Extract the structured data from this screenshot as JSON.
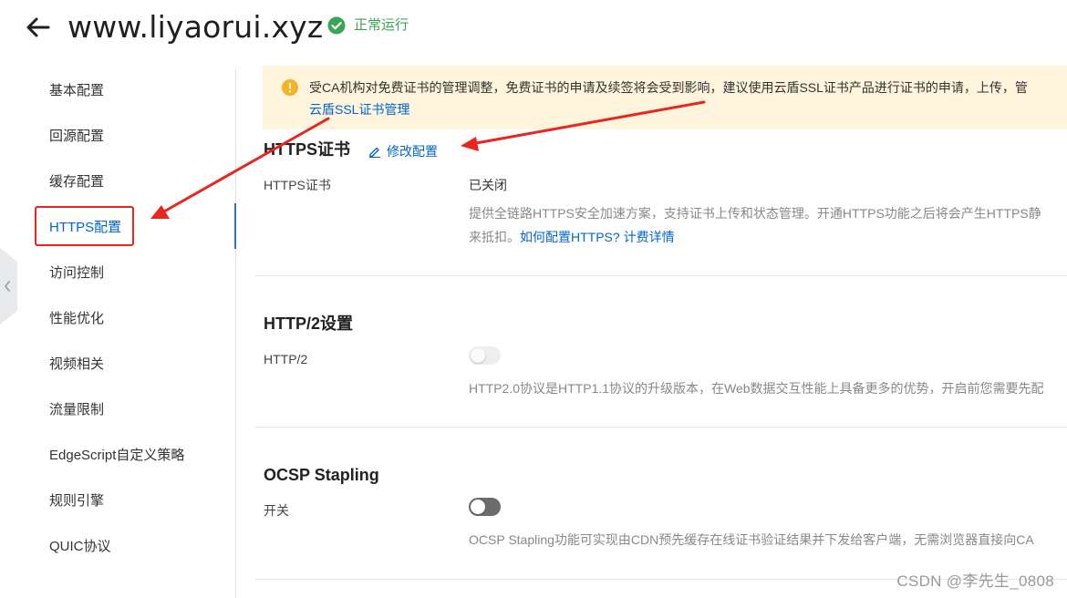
{
  "header": {
    "back_icon": "arrow-left-icon",
    "title": "www.liyaorui.xyz",
    "status_icon": "check-circle-icon",
    "status_text": "正常运行",
    "status_color": "#3aa655"
  },
  "sidebar": {
    "items": [
      {
        "label": "基本配置",
        "active": false
      },
      {
        "label": "回源配置",
        "active": false
      },
      {
        "label": "缓存配置",
        "active": false
      },
      {
        "label": "HTTPS配置",
        "active": true
      },
      {
        "label": "访问控制",
        "active": false
      },
      {
        "label": "性能优化",
        "active": false
      },
      {
        "label": "视频相关",
        "active": false
      },
      {
        "label": "流量限制",
        "active": false
      },
      {
        "label": "EdgeScript自定义策略",
        "active": false
      },
      {
        "label": "规则引擎",
        "active": false
      },
      {
        "label": "QUIC协议",
        "active": false
      }
    ]
  },
  "notice": {
    "icon": "warning-circle-icon",
    "text": "受CA机构对免费证书的管理调整，免费证书的申请及续签将会受到影响，建议使用云盾SSL证书产品进行证书的申请，上传，管",
    "link": "云盾SSL证书管理"
  },
  "https_section": {
    "title": "HTTPS证书",
    "edit_icon": "pencil-icon",
    "edit_label": "修改配置",
    "field_label": "HTTPS证书",
    "field_value": "已关闭",
    "desc_line1": "提供全链路HTTPS安全加速方案，支持证书上传和状态管理。开通HTTPS功能之后将会产生HTTPS静",
    "desc_line2_prefix": "来抵扣。",
    "desc_link1": "如何配置HTTPS?",
    "desc_link2": "计费详情"
  },
  "http2_section": {
    "title": "HTTP/2设置",
    "field_label": "HTTP/2",
    "toggle_on": false,
    "toggle_disabled": true,
    "desc": "HTTP2.0协议是HTTP1.1协议的升级版本，在Web数据交互性能上具备更多的优势，开启前您需要先配"
  },
  "ocsp_section": {
    "title": "OCSP Stapling",
    "field_label": "开关",
    "toggle_on": false,
    "toggle_disabled": false,
    "desc": "OCSP Stapling功能可实现由CDN预先缓存在线证书验证结果并下发给客户端，无需浏览器直接向CA"
  },
  "watermark": "CSDN @李先生_0808",
  "colors": {
    "accent": "#0066cc",
    "annotation_red": "#e8251f",
    "notice_bg": "#fff4dc",
    "warning": "#f5b323"
  }
}
